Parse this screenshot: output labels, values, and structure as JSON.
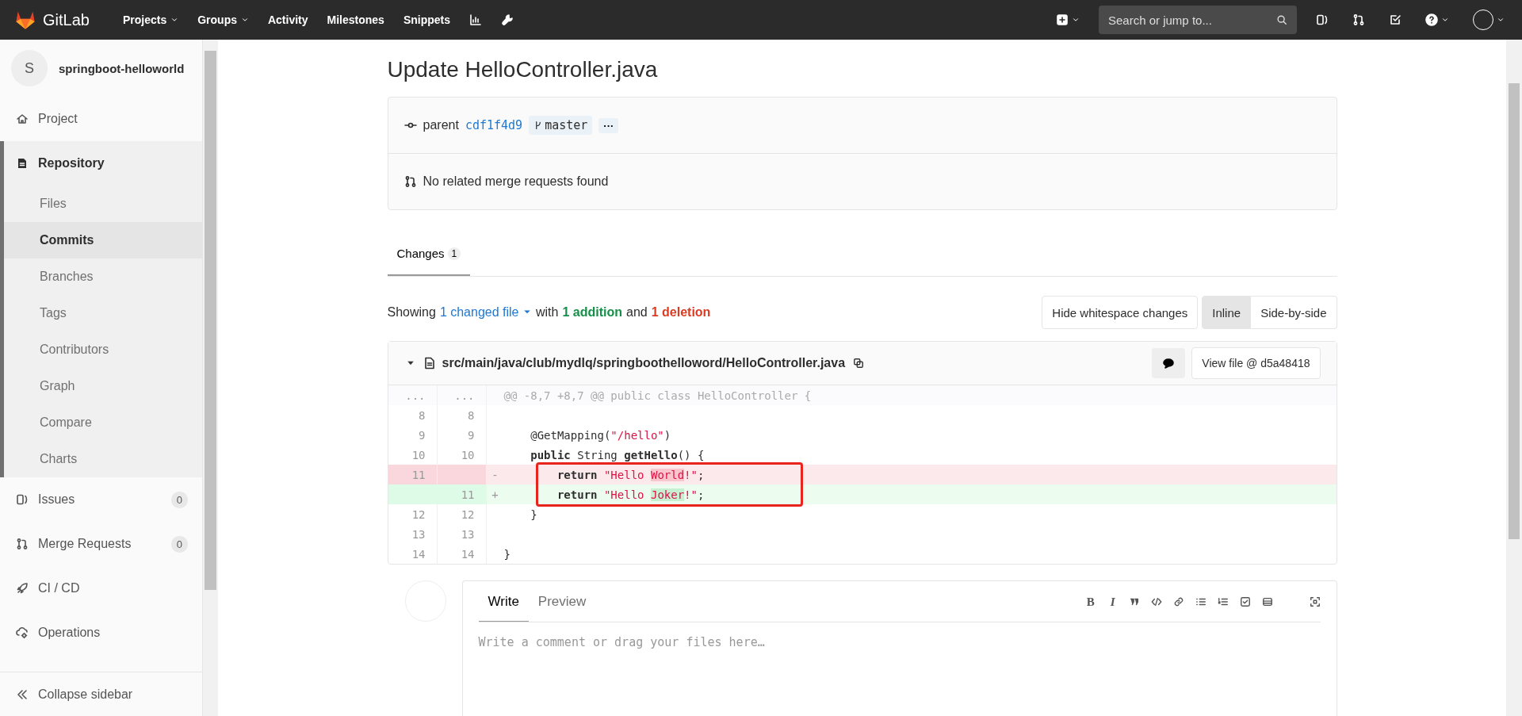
{
  "topbar": {
    "brand": "GitLab",
    "nav": [
      {
        "label": "Projects",
        "dropdown": true
      },
      {
        "label": "Groups",
        "dropdown": true
      },
      {
        "label": "Activity",
        "dropdown": false
      },
      {
        "label": "Milestones",
        "dropdown": false
      },
      {
        "label": "Snippets",
        "dropdown": false
      }
    ],
    "search": {
      "placeholder": "Search or jump to..."
    }
  },
  "sidebar": {
    "avatar_letter": "S",
    "project_name": "springboot-helloworld",
    "items": [
      {
        "label": "Project",
        "selected": false
      },
      {
        "label": "Repository",
        "selected": true,
        "children": [
          {
            "label": "Files",
            "selected": false
          },
          {
            "label": "Commits",
            "selected": true
          },
          {
            "label": "Branches",
            "selected": false
          },
          {
            "label": "Tags",
            "selected": false
          },
          {
            "label": "Contributors",
            "selected": false
          },
          {
            "label": "Graph",
            "selected": false
          },
          {
            "label": "Compare",
            "selected": false
          },
          {
            "label": "Charts",
            "selected": false
          }
        ]
      },
      {
        "label": "Issues",
        "selected": false,
        "count": "0"
      },
      {
        "label": "Merge Requests",
        "selected": false,
        "count": "0"
      },
      {
        "label": "CI / CD",
        "selected": false
      },
      {
        "label": "Operations",
        "selected": false
      }
    ],
    "collapse_label": "Collapse sidebar"
  },
  "commit": {
    "title": "Update HelloController.java",
    "parent_label": "parent",
    "parent_sha": "cdf1f4d9",
    "branch": "master",
    "more": "···",
    "merge_requests": "No related merge requests found"
  },
  "tabs": [
    {
      "label": "Changes",
      "count": "1",
      "selected": true
    }
  ],
  "summary": {
    "prefix": "Showing",
    "changed_files": "1 changed file",
    "with": "with",
    "additions": "1 addition",
    "and": "and",
    "deletions": "1 deletion"
  },
  "diff_options": {
    "whitespace_button": "Hide whitespace changes",
    "views": [
      {
        "label": "Inline",
        "selected": true
      },
      {
        "label": "Side-by-side",
        "selected": false
      }
    ]
  },
  "file": {
    "path": "src/main/java/club/mydlq/springboothelloword/HelloController.java",
    "expanded": true,
    "view_button": "View file @ d5a48418",
    "lines": [
      {
        "kind": "hunk",
        "old": "...",
        "new": "...",
        "code": [
          {
            "kind": "plain",
            "text": "@@ -8,7 +8,7 @@ public class HelloController {"
          }
        ]
      },
      {
        "kind": "context",
        "old": "8",
        "new": "8"
      },
      {
        "kind": "context",
        "old": "9",
        "new": "9",
        "code": [
          {
            "kind": "plain",
            "text": "    @GetMapping("
          },
          {
            "kind": "string",
            "text": "\"/hello\""
          },
          {
            "kind": "plain",
            "text": ")"
          }
        ]
      },
      {
        "kind": "context",
        "old": "10",
        "new": "10",
        "code": [
          {
            "kind": "keyword",
            "text": "    public"
          },
          {
            "kind": "plain",
            "text": " String "
          },
          {
            "kind": "keyword",
            "text": "getHello"
          },
          {
            "kind": "plain",
            "text": "() {"
          }
        ]
      },
      {
        "kind": "removed",
        "old": "11",
        "sign": "-",
        "code": [
          {
            "kind": "keyword",
            "text": "        return "
          },
          {
            "kind": "string",
            "text": "\"Hello "
          },
          {
            "kind": "change",
            "text": "World"
          },
          {
            "kind": "string",
            "text": "!\""
          },
          {
            "kind": "plain",
            "text": ";"
          }
        ]
      },
      {
        "kind": "added",
        "new": "11",
        "sign": "+",
        "code": [
          {
            "kind": "keyword",
            "text": "        return "
          },
          {
            "kind": "string",
            "text": "\"Hello "
          },
          {
            "kind": "change",
            "text": "Joker"
          },
          {
            "kind": "string",
            "text": "!\""
          },
          {
            "kind": "plain",
            "text": ";"
          }
        ]
      },
      {
        "kind": "context",
        "old": "12",
        "new": "12",
        "code": [
          {
            "kind": "plain",
            "text": "    }"
          }
        ]
      },
      {
        "kind": "context",
        "old": "13",
        "new": "13"
      },
      {
        "kind": "context",
        "old": "14",
        "new": "14",
        "code": [
          {
            "kind": "plain",
            "text": "}"
          }
        ]
      }
    ]
  },
  "comment": {
    "tabs": [
      {
        "label": "Write",
        "selected": true
      },
      {
        "label": "Preview",
        "selected": false
      }
    ],
    "format_buttons": [
      {
        "kind": "bold",
        "label": "B"
      },
      {
        "kind": "italic",
        "label": "I"
      }
    ],
    "placeholder": "Write a comment or drag your files here…"
  }
}
